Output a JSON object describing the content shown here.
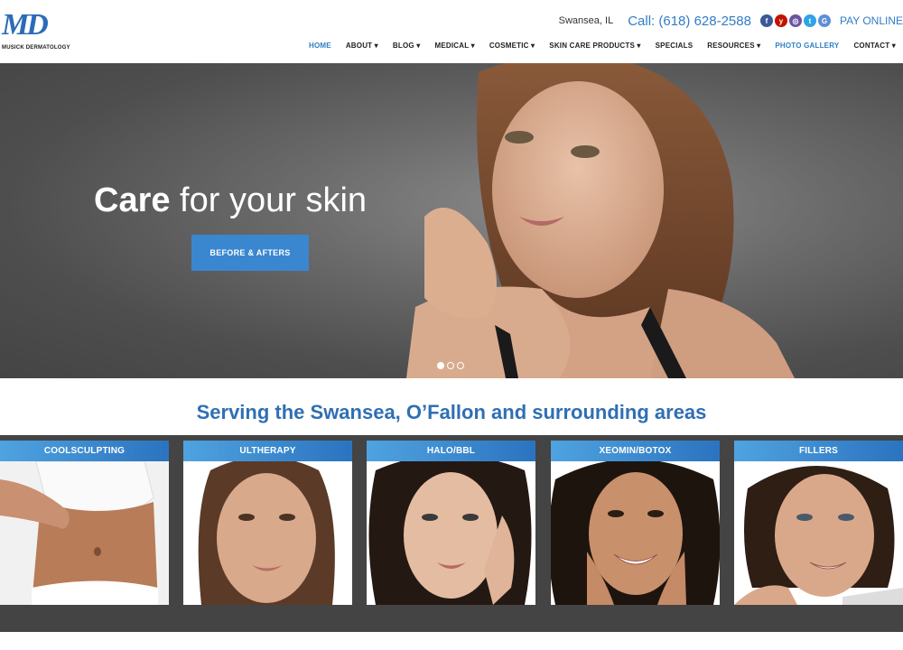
{
  "brand": {
    "logo_mark": "MD",
    "logo_sub": "MUSICK DERMATOLOGY"
  },
  "topbar": {
    "location": "Swansea, IL",
    "phone": "Call: (618) 628-2588",
    "pay": "PAY ONLINE"
  },
  "social": [
    {
      "icon": "facebook-icon",
      "glyph": "f",
      "color": "#3b5998"
    },
    {
      "icon": "yelp-icon",
      "glyph": "y",
      "color": "#c41200"
    },
    {
      "icon": "instagram-icon",
      "glyph": "◎",
      "color": "#6a55a0"
    },
    {
      "icon": "twitter-icon",
      "glyph": "t",
      "color": "#2fa3e6"
    },
    {
      "icon": "google-plus-icon",
      "glyph": "G",
      "color": "#5b8fd6"
    }
  ],
  "nav": [
    {
      "label": "HOME"
    },
    {
      "label": "ABOUT ▾"
    },
    {
      "label": "BLOG ▾"
    },
    {
      "label": "MEDICAL ▾"
    },
    {
      "label": "COSMETIC ▾"
    },
    {
      "label": "SKIN CARE PRODUCTS ▾"
    },
    {
      "label": "SPECIALS"
    },
    {
      "label": "RESOURCES ▾"
    },
    {
      "label": "PHOTO GALLERY"
    },
    {
      "label": "CONTACT ▾"
    }
  ],
  "hero": {
    "title_bold": "Care",
    "title_rest": " for your skin",
    "button": "BEFORE & AFTERS"
  },
  "serving": "Serving the Swansea, O’Fallon and surrounding areas",
  "services": [
    {
      "label": "COOLSCULPTING"
    },
    {
      "label": "ULTHERAPY"
    },
    {
      "label": "HALO/BBL"
    },
    {
      "label": "XEOMIN/BOTOX"
    },
    {
      "label": "FILLERS"
    }
  ],
  "colors": {
    "accent": "#2f7ec4",
    "heading": "#2f6fb4",
    "band": "#444444",
    "button": "#3a87d0"
  }
}
